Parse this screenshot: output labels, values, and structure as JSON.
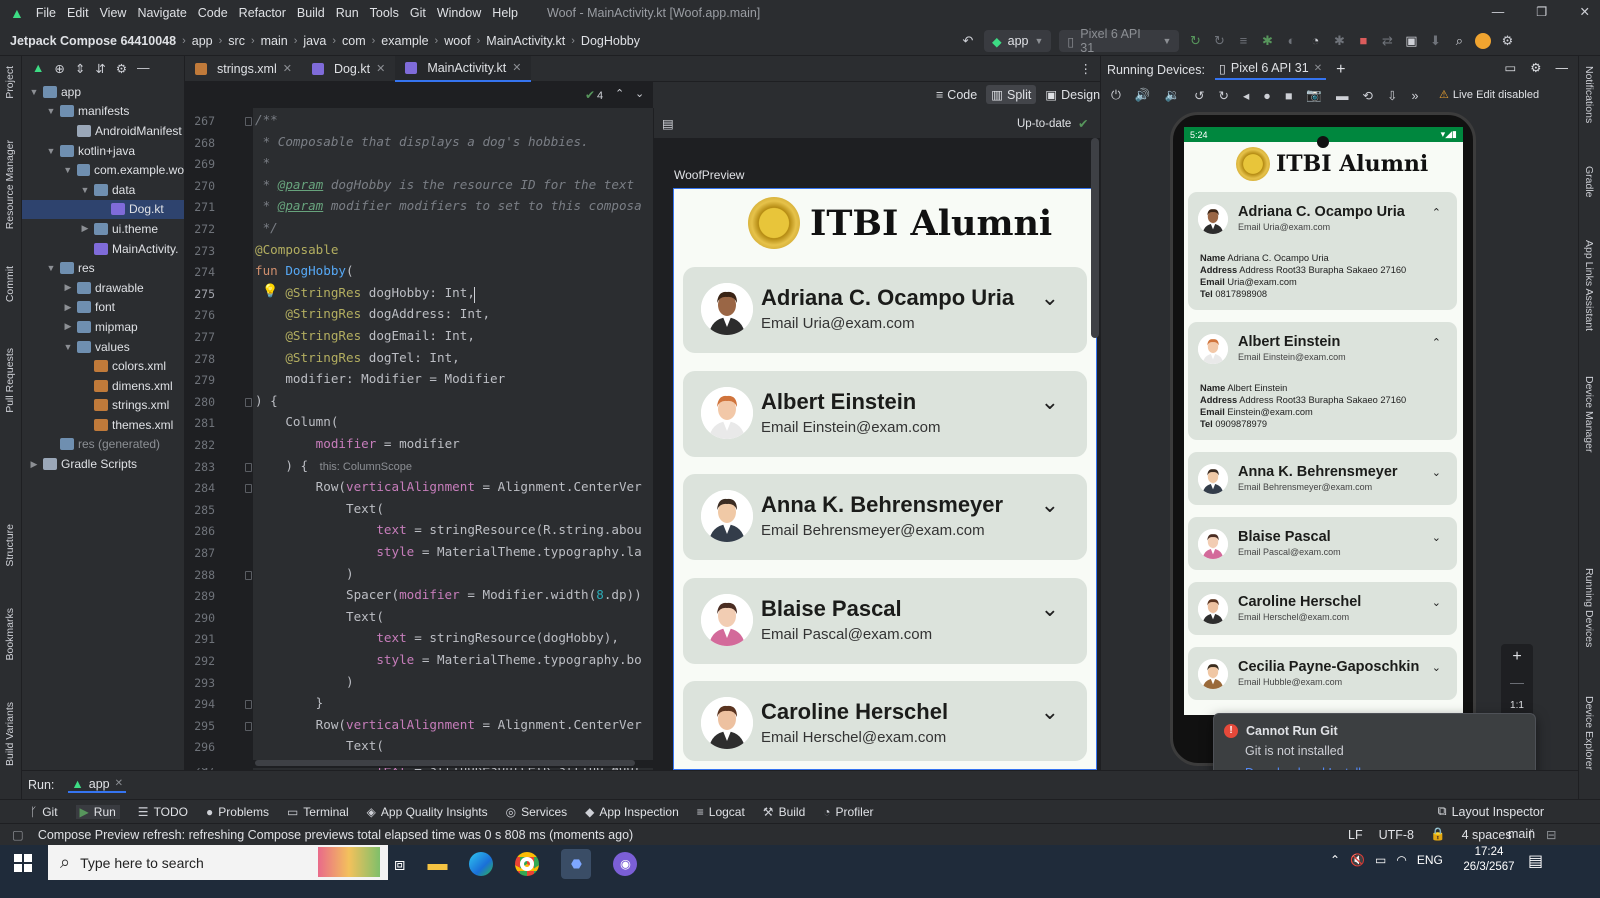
{
  "window_title": "Woof - MainActivity.kt [Woof.app.main]",
  "menu": [
    "File",
    "Edit",
    "View",
    "Navigate",
    "Code",
    "Refactor",
    "Build",
    "Run",
    "Tools",
    "Git",
    "Window",
    "Help"
  ],
  "breadcrumb": [
    "Jetpack Compose 64410048",
    "app",
    "src",
    "main",
    "java",
    "com",
    "example",
    "woof",
    "MainActivity.kt",
    "DogHobby"
  ],
  "toolbar": {
    "run_config": "app",
    "device": "Pixel 6 API 31"
  },
  "left_strip": [
    "Project",
    "Resource Manager",
    "Commit",
    "Pull Requests",
    "Structure",
    "Bookmarks",
    "Build Variants"
  ],
  "right_strip": [
    "Notifications",
    "Gradle",
    "App Links Assistant",
    "Device Manager",
    "Running Devices",
    "Device Explorer"
  ],
  "tree": [
    {
      "label": "app",
      "depth": 0,
      "fold": "v",
      "icon": "folder"
    },
    {
      "label": "manifests",
      "depth": 1,
      "fold": "v",
      "icon": "folder"
    },
    {
      "label": "AndroidManifest",
      "depth": 2,
      "fold": "",
      "icon": "file"
    },
    {
      "label": "kotlin+java",
      "depth": 1,
      "fold": "v",
      "icon": "folder"
    },
    {
      "label": "com.example.wo",
      "depth": 2,
      "fold": "v",
      "icon": "folder"
    },
    {
      "label": "data",
      "depth": 3,
      "fold": "v",
      "icon": "folder"
    },
    {
      "label": "Dog.kt",
      "depth": 4,
      "fold": "",
      "icon": "kt",
      "selected": true
    },
    {
      "label": "ui.theme",
      "depth": 3,
      "fold": ">",
      "icon": "folder"
    },
    {
      "label": "MainActivity.",
      "depth": 3,
      "fold": "",
      "icon": "kt"
    },
    {
      "label": "res",
      "depth": 1,
      "fold": "v",
      "icon": "folder"
    },
    {
      "label": "drawable",
      "depth": 2,
      "fold": ">",
      "icon": "folder"
    },
    {
      "label": "font",
      "depth": 2,
      "fold": ">",
      "icon": "folder"
    },
    {
      "label": "mipmap",
      "depth": 2,
      "fold": ">",
      "icon": "folder"
    },
    {
      "label": "values",
      "depth": 2,
      "fold": "v",
      "icon": "folder"
    },
    {
      "label": "colors.xml",
      "depth": 3,
      "fold": "",
      "icon": "xml"
    },
    {
      "label": "dimens.xml",
      "depth": 3,
      "fold": "",
      "icon": "xml"
    },
    {
      "label": "strings.xml",
      "depth": 3,
      "fold": "",
      "icon": "xml"
    },
    {
      "label": "themes.xml",
      "depth": 3,
      "fold": "",
      "icon": "xml"
    },
    {
      "label": "res (generated)",
      "depth": 1,
      "fold": "",
      "icon": "folder"
    },
    {
      "label": "Gradle Scripts",
      "depth": 0,
      "fold": ">",
      "icon": "file"
    }
  ],
  "editor_tabs": [
    "strings.xml",
    "Dog.kt",
    "MainActivity.kt"
  ],
  "view_modes": [
    "Code",
    "Split",
    "Design"
  ],
  "inspection_count": "4",
  "code_start_line": 267,
  "code_lines": [
    [
      [
        "c-cm",
        "/**"
      ]
    ],
    [
      [
        "c-cm",
        " * Composable that displays a dog's hobbies."
      ]
    ],
    [
      [
        "c-cm",
        " *"
      ]
    ],
    [
      [
        "c-cm",
        " * "
      ],
      [
        "c-doc",
        "@param"
      ],
      [
        "c-cm",
        " dogHobby is the resource ID for the text"
      ]
    ],
    [
      [
        "c-cm",
        " * "
      ],
      [
        "c-doc",
        "@param"
      ],
      [
        "c-cm",
        " modifier modifiers to set to this composa"
      ]
    ],
    [
      [
        "c-cm",
        " */"
      ]
    ],
    [
      [
        "c-an",
        "@Composable"
      ]
    ],
    [
      [
        "c-kw",
        "fun "
      ],
      [
        "c-fn",
        "DogHobby"
      ],
      [
        "",
        "("
      ]
    ],
    [
      [
        "",
        "    "
      ],
      [
        "c-an",
        "@StringRes"
      ],
      [
        "",
        " dogHobby: Int,"
      ]
    ],
    [
      [
        "",
        "    "
      ],
      [
        "c-an",
        "@StringRes"
      ],
      [
        "",
        " dogAddress: Int,"
      ]
    ],
    [
      [
        "",
        "    "
      ],
      [
        "c-an",
        "@StringRes"
      ],
      [
        "",
        " dogEmail: Int,"
      ]
    ],
    [
      [
        "",
        "    "
      ],
      [
        "c-an",
        "@StringRes"
      ],
      [
        "",
        " dogTel: Int,"
      ]
    ],
    [
      [
        "",
        "    modifier: Modifier = Modifier"
      ]
    ],
    [
      [
        "",
        ") {"
      ]
    ],
    [
      [
        "",
        "    Column("
      ]
    ],
    [
      [
        "",
        "        "
      ],
      [
        "c-pr",
        "modifier"
      ],
      [
        "",
        " = modifier"
      ]
    ],
    [
      [
        "",
        "    ) { "
      ],
      [
        "c-hint",
        "this: ColumnScope"
      ]
    ],
    [
      [
        "",
        "        Row("
      ],
      [
        "c-pr",
        "verticalAlignment"
      ],
      [
        "",
        " = Alignment.CenterVer"
      ]
    ],
    [
      [
        "",
        "            Text("
      ]
    ],
    [
      [
        "",
        "                "
      ],
      [
        "c-pr",
        "text"
      ],
      [
        "",
        " = stringResource(R.string.abou"
      ]
    ],
    [
      [
        "",
        "                "
      ],
      [
        "c-pr",
        "style"
      ],
      [
        "",
        " = MaterialTheme.typography.la"
      ]
    ],
    [
      [
        "",
        "            )"
      ]
    ],
    [
      [
        "",
        "            Spacer("
      ],
      [
        "c-pr",
        "modifier"
      ],
      [
        "",
        " = Modifier.width("
      ],
      [
        "c-nm",
        "8"
      ],
      [
        "",
        ".dp))"
      ]
    ],
    [
      [
        "",
        "            Text("
      ]
    ],
    [
      [
        "",
        "                "
      ],
      [
        "c-pr",
        "text"
      ],
      [
        "",
        " = stringResource(dogHobby),"
      ]
    ],
    [
      [
        "",
        "                "
      ],
      [
        "c-pr",
        "style"
      ],
      [
        "",
        " = MaterialTheme.typography.bo"
      ]
    ],
    [
      [
        "",
        "            )"
      ]
    ],
    [
      [
        "",
        "        }"
      ]
    ],
    [
      [
        "",
        "        Row("
      ],
      [
        "c-pr",
        "verticalAlignment"
      ],
      [
        "",
        " = Alignment.CenterVer"
      ]
    ],
    [
      [
        "",
        "            Text("
      ]
    ],
    [
      [
        "",
        "                "
      ],
      [
        "c-pr",
        "text"
      ],
      [
        "",
        " = stringResource(R.string.Addr"
      ]
    ]
  ],
  "preview": {
    "status": "Up-to-date",
    "name": "WoofPreview",
    "app_title": "ITBI Alumni",
    "cards": [
      {
        "name": "Adriana C. Ocampo Uria",
        "email": "Email Uria@exam.com",
        "hair": "#3a2415",
        "skin": "#9a6645",
        "suit": "#2c2c2c"
      },
      {
        "name": "Albert Einstein",
        "email": "Email Einstein@exam.com",
        "hair": "#d0743c",
        "skin": "#f2c8a8",
        "suit": "#e9e9e9"
      },
      {
        "name": "Anna K. Behrensmeyer",
        "email": "Email Behrensmeyer@exam.com",
        "hair": "#3b2c22",
        "skin": "#f0c9a6",
        "suit": "#333d4a"
      },
      {
        "name": "Blaise Pascal",
        "email": "Email Pascal@exam.com",
        "hair": "#4a2d22",
        "skin": "#f2cdb3",
        "suit": "#d36a9a"
      },
      {
        "name": "Caroline Herschel",
        "email": "Email Herschel@exam.com",
        "hair": "#5a3420",
        "skin": "#edc1a0",
        "suit": "#2e2e2e"
      }
    ]
  },
  "running_devices": {
    "label": "Running Devices:",
    "device_tab": "Pixel 6 API 31",
    "live_edit": "Live Edit disabled",
    "zoom": "1:1"
  },
  "phone": {
    "time": "5:24",
    "app_title": "ITBI Alumni",
    "cards": [
      {
        "name": "Adriana C. Ocampo Uria",
        "email": "Email Uria@exam.com",
        "expanded": true,
        "chev": "^",
        "details": [
          [
            "Name",
            "Adriana C. Ocampo Uria"
          ],
          [
            "Address",
            "Address Root33 Burapha Sakaeo 27160"
          ],
          [
            "Email",
            "Uria@exam.com"
          ],
          [
            "Tel",
            "0817898908"
          ]
        ]
      },
      {
        "name": "Albert Einstein",
        "email": "Email Einstein@exam.com",
        "expanded": true,
        "chev": "^",
        "details": [
          [
            "Name",
            "Albert Einstein"
          ],
          [
            "Address",
            "Address Root33 Burapha Sakaeo 27160"
          ],
          [
            "Email",
            "Einstein@exam.com"
          ],
          [
            "Tel",
            "0909878979"
          ]
        ]
      },
      {
        "name": "Anna K. Behrensmeyer",
        "email": "Email Behrensmeyer@exam.com",
        "expanded": false,
        "chev": "v"
      },
      {
        "name": "Blaise Pascal",
        "email": "Email Pascal@exam.com",
        "expanded": false,
        "chev": "v"
      },
      {
        "name": "Caroline Herschel",
        "email": "Email Herschel@exam.com",
        "expanded": false,
        "chev": "v"
      },
      {
        "name": "Cecilia Payne-Gaposchkin",
        "email": "Email Hubble@exam.com",
        "expanded": false,
        "chev": "v"
      }
    ]
  },
  "notification": {
    "title": "Cannot Run Git",
    "body": "Git is not installed",
    "link": "Download and Install"
  },
  "run_bar": {
    "label": "Run:",
    "config": "app"
  },
  "tool_windows": [
    "Git",
    "Run",
    "TODO",
    "Problems",
    "Terminal",
    "App Quality Insights",
    "Services",
    "App Inspection",
    "Logcat",
    "Build",
    "Profiler"
  ],
  "layout_inspector": "Layout Inspector",
  "status_message": "Compose Preview refresh: refreshing Compose previews total elapsed time was 0 s 808 ms (moments ago)",
  "status_right": [
    "LF",
    "UTF-8",
    "4 spaces",
    "main"
  ],
  "taskbar": {
    "search_placeholder": "Type here to search",
    "time": "17:24",
    "date": "26/3/2567",
    "lang": "ENG"
  },
  "colors": {
    "accent": "#3574f0",
    "card": "#dce3dc",
    "phone_green": "#00873e",
    "error": "#e5493a"
  }
}
